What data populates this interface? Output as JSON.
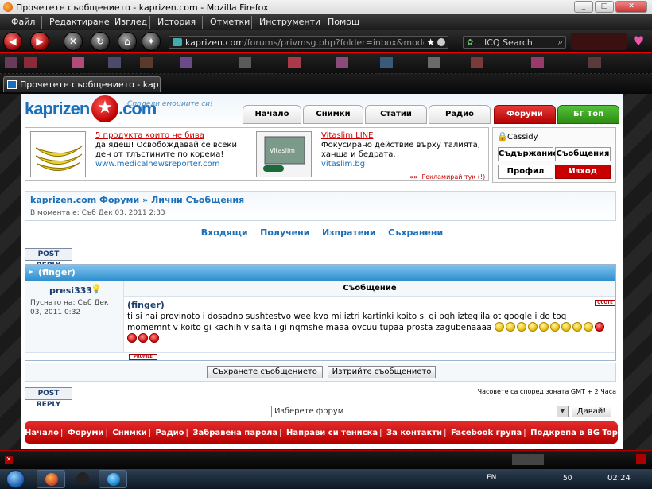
{
  "window": {
    "title": "Прочетете съобщението - kaprizen.com - Mozilla Firefox",
    "buttons": {
      "minimize": "_",
      "maximize": "□",
      "close": "✕"
    }
  },
  "menu": [
    "Файл",
    "Редактиране",
    "Изглед",
    "История",
    "Отметки",
    "Инструменти",
    "Помощ"
  ],
  "urlbar": {
    "domain": "kaprizen.com",
    "path": "/forums/privmsg.php?folder=inbox&mode=read&"
  },
  "searchbar": {
    "placeholder": "ICQ Search"
  },
  "tab": {
    "label": "Прочетете съобщението - kaprizen.com"
  },
  "site": {
    "logo_left": "kaprizen",
    "logo_right": ".com",
    "slogan": "Сподели емоциите си!",
    "nav": [
      "Начало",
      "Снимки",
      "Статии",
      "Радио",
      "Форуми",
      "БГ Топ"
    ]
  },
  "ads": [
    {
      "title": "5 продукта които не бива",
      "desc": "да ядеш! Освобождавай се всеки ден от тлъстините по корема!",
      "link": "www.medicalnewsreporter.com"
    },
    {
      "title": "Vitaslim LINE",
      "desc": "Фокусирано действие върху талията, ханша и бедрата.",
      "link": "vitaslim.bg"
    }
  ],
  "ads_report": "Рекламирай тук (!)",
  "user": {
    "name": "Cassidy",
    "buttons": [
      "Съдържание",
      "Съобщения",
      "Профил",
      "Изход"
    ]
  },
  "breadcrumb": {
    "home": "kaprizen.com Форуми",
    "sep": "»",
    "current": "Лични Съобщения"
  },
  "current_time": "В момента е: Съб Дек 03, 2011 2:33",
  "folders": [
    "Входящи",
    "Получени",
    "Изпратени",
    "Съхранени"
  ],
  "post_reply": "POST REPLY",
  "message": {
    "header_title": "(finger)",
    "col_message": "Съобщение",
    "author": "presi333",
    "posted": "Пуснато на: Съб Дек 03, 2011 0:32",
    "subject": "(finger)",
    "body": "ti si nai provinoto i dosadno sushtestvo wee kvo mi iztri kartinki koito si gi bgh izteglila ot google i do toq momemnt v koito gi kachih v saita i gi nqmshe maaa ovcuu tupaa prosta zagubenaaaa",
    "quote_btn": "QUOTE",
    "profile_btn": "PROFILE",
    "emoticons": [
      "y",
      "y",
      "y",
      "y",
      "y",
      "y",
      "y",
      "y",
      "y",
      "r",
      "r",
      "r",
      "r"
    ]
  },
  "actions": {
    "save": "Съхранете съобщението",
    "delete": "Изтрийте съобщението"
  },
  "timezone": "Часовете са според зоната GMT + 2 Часа",
  "forum_select": {
    "value": "Изберете форум",
    "go": "Давай!"
  },
  "footer_links": [
    "Начало",
    "Форуми",
    "Снимки",
    "Радио",
    "Забравена парола",
    "Направи си тениска",
    "За контакти",
    "Facebook група",
    "Подкрепа в BG Top"
  ],
  "taskbar": {
    "lang": "EN",
    "tray_value": "50",
    "clock": "02:24"
  }
}
